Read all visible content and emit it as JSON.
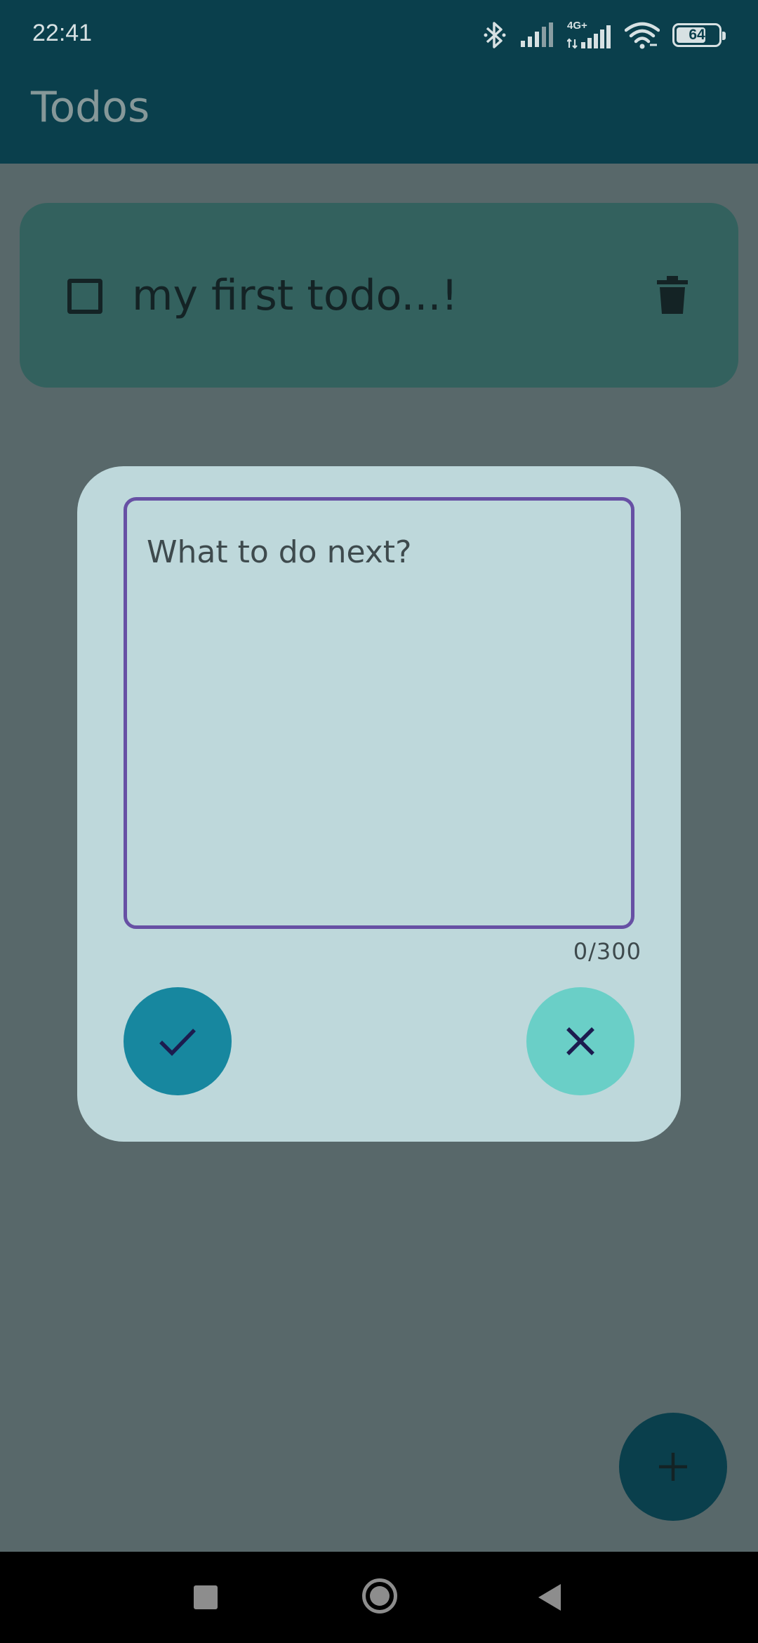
{
  "status_bar": {
    "time": "22:41",
    "network_label": "4G+",
    "battery": "64"
  },
  "app_bar": {
    "title": "Todos"
  },
  "todos": [
    {
      "text": "my first todo...!",
      "checked": false
    }
  ],
  "dialog": {
    "input": {
      "placeholder": "What to do next?",
      "value": ""
    },
    "counter": "0/300",
    "confirm_icon": "check-icon",
    "cancel_icon": "close-icon"
  },
  "fab_icon": "plus-icon",
  "nav_bar": {
    "icons": [
      "recents-icon",
      "home-icon",
      "back-icon"
    ]
  },
  "colors": {
    "app_bar": "#0a3f4c",
    "scrim_background": "#58686a",
    "todo_card": "#33615e",
    "dialog_surface": "#bed8db",
    "input_border": "#6750a4",
    "confirm_button": "#17879f",
    "cancel_button": "#6acfc7"
  }
}
